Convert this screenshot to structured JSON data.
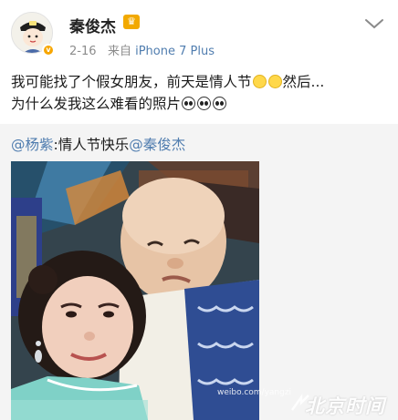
{
  "author": {
    "name": "秦俊杰",
    "date": "2-16",
    "source_prefix": "来自",
    "device": "iPhone 7 Plus",
    "verified_badge": "v",
    "vip_icon": "crown-icon"
  },
  "post": {
    "line1": "我可能找了个假女朋友，前天是情人节",
    "line1_suffix": "然后...",
    "line2": "为什么发我这么难看的照片"
  },
  "repost": {
    "mention1": "@杨紫",
    "text": ":情人节快乐",
    "mention2": "@秦俊杰"
  },
  "watermarks": {
    "weibo": "weibo.com/yangzi",
    "site": "北京时间"
  },
  "colors": {
    "link": "#507daf",
    "meta": "#8c8c8c",
    "repost_bg": "#f4f4f4",
    "vip": "#f2a900"
  }
}
